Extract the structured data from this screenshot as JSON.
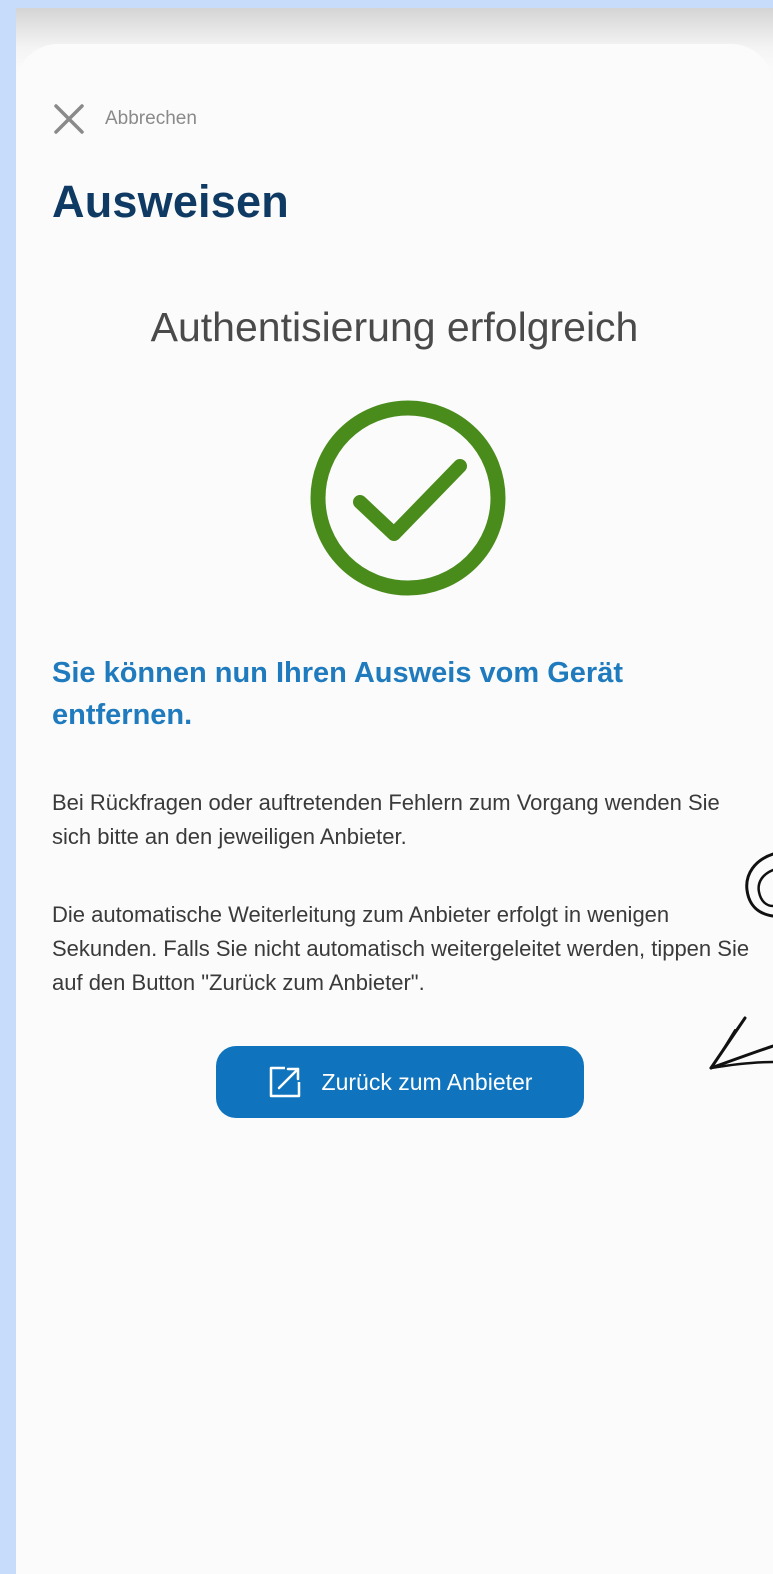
{
  "header": {
    "cancel_label": "Abbrechen",
    "cancel_icon": "close-icon"
  },
  "main": {
    "title": "Ausweisen",
    "status_title": "Authentisierung erfolgreich",
    "status_icon": "checkmark-circle-icon",
    "headline": "Sie können nun Ihren Ausweis vom Gerät entfernen.",
    "paragraph_1": "Bei Rückfragen oder auftretenden Fehlern zum Vorgang wenden Sie sich bitte an den jeweiligen Anbieter.",
    "paragraph_2": "Die automatische Weiterleitung zum Anbieter erfolgt in wenigen Sekunden. Falls Sie nicht automatisch weitergeleitet werden, tippen Sie auf den Button \"Zurück zum Anbieter\"."
  },
  "action": {
    "button_label": "Zurück zum Anbieter",
    "button_icon": "external-link-icon"
  },
  "colors": {
    "background": "#c7dcfb",
    "title": "#0e3a63",
    "accent": "#1f7bbd",
    "button": "#0f74bd",
    "success": "#4a8c1c"
  },
  "annotation": {
    "icon": "arrow-scribble-icon"
  }
}
